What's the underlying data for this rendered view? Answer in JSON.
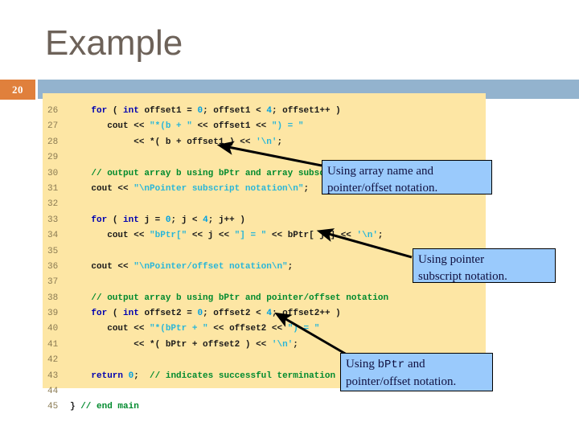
{
  "slide": {
    "title": "Example",
    "number": "20",
    "accent_orange": "#e0803c",
    "band_blue": "#93b3ce",
    "code_bg": "#fde6a4",
    "callout_bg": "#9acafc",
    "title_color": "#6d6259"
  },
  "code": {
    "language": "cpp",
    "lines": [
      {
        "n": "26",
        "text": "    for ( int offset1 = 0; offset1 < 4; offset1++ )"
      },
      {
        "n": "27",
        "text": "       cout << \"*(b + \" << offset1 << \") = \""
      },
      {
        "n": "28",
        "text": "            << *( b + offset1 ) << '\\n';"
      },
      {
        "n": "29",
        "text": ""
      },
      {
        "n": "30",
        "text": "    // output array b using bPtr and array subscript notation"
      },
      {
        "n": "31",
        "text": "    cout << \"\\nPointer subscript notation\\n\";"
      },
      {
        "n": "32",
        "text": ""
      },
      {
        "n": "33",
        "text": "    for ( int j = 0; j < 4; j++ )"
      },
      {
        "n": "34",
        "text": "       cout << \"bPtr[\" << j << \"] = \" << bPtr[ j ] << '\\n';"
      },
      {
        "n": "35",
        "text": ""
      },
      {
        "n": "36",
        "text": "    cout << \"\\nPointer/offset notation\\n\";"
      },
      {
        "n": "37",
        "text": ""
      },
      {
        "n": "38",
        "text": "    // output array b using bPtr and pointer/offset notation"
      },
      {
        "n": "39",
        "text": "    for ( int offset2 = 0; offset2 < 4; offset2++ )"
      },
      {
        "n": "40",
        "text": "       cout << \"*(bPtr + \" << offset2 << \") = \""
      },
      {
        "n": "41",
        "text": "            << *( bPtr + offset2 ) << '\\n';"
      },
      {
        "n": "42",
        "text": ""
      },
      {
        "n": "43",
        "text": "    return 0;  // indicates successful termination"
      },
      {
        "n": "44",
        "text": ""
      },
      {
        "n": "45",
        "text": "} // end main"
      }
    ]
  },
  "callouts": [
    {
      "id": "callout-1",
      "line1": "Using array name and",
      "line2": "pointer/offset notation."
    },
    {
      "id": "callout-2",
      "line1": "Using pointer",
      "line2": "subscript notation."
    },
    {
      "id": "callout-3",
      "line1_pre": "Using ",
      "line1_mono": "bPtr",
      "line1_post": " and",
      "line2": "pointer/offset notation."
    }
  ]
}
